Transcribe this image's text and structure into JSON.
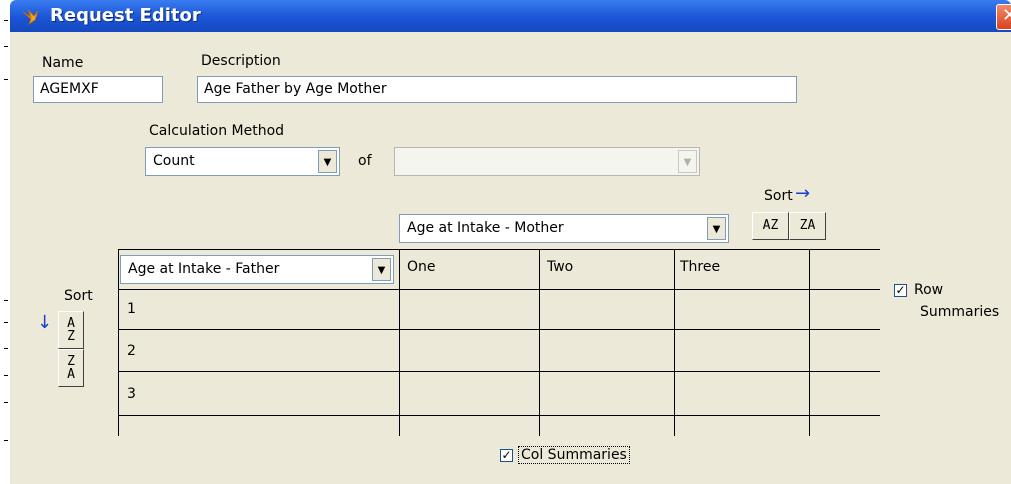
{
  "window": {
    "title": "Request Editor",
    "close_glyph": "✕"
  },
  "fields": {
    "name_label": "Name",
    "name_value": "AGEMXF",
    "description_label": "Description",
    "description_value": "Age Father by Age Mother",
    "calc_method_label": "Calculation Method",
    "calc_method_value": "Count",
    "of_label": "of",
    "of_value": ""
  },
  "column_sort": {
    "label": "Sort",
    "arrow": "→",
    "az": "AZ",
    "za": "ZA"
  },
  "row_sort": {
    "label": "Sort",
    "arrow": "↓",
    "az_top": "A",
    "az_bottom": "Z",
    "za_top": "Z",
    "za_bottom": "A"
  },
  "grid": {
    "column_variable": "Age at Intake - Mother",
    "row_variable": "Age at Intake - Father",
    "columns": [
      "One",
      "Two",
      "Three"
    ],
    "rows": [
      "1",
      "2",
      "3"
    ]
  },
  "options": {
    "row_summaries_line1": "Row",
    "row_summaries_line2": "Summaries",
    "row_summaries_checked": true,
    "col_summaries": "Col Summaries",
    "col_summaries_checked": true
  },
  "check_glyph": "✓",
  "dropdown_glyph": "▼",
  "colors": {
    "titlebar": "#1b55d6",
    "dialog_bg": "#ece9d8",
    "sort_arrow": "#1a3fd0"
  }
}
